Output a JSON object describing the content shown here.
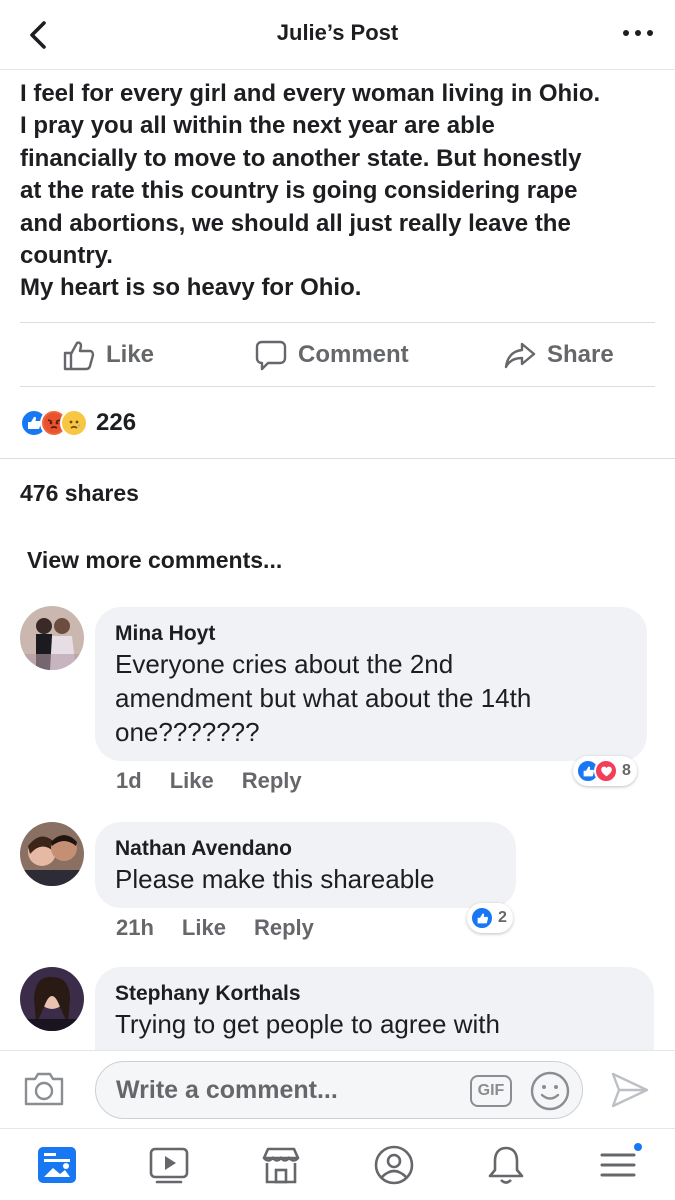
{
  "header": {
    "title": "Julie’s Post"
  },
  "post": {
    "lines": [
      "I feel for every girl and every woman living in Ohio.",
      "I pray you all within the next year are able",
      "financially to move to another state. But honestly",
      "at the rate this country is going considering rape",
      "and abortions, we should all just really leave the",
      "country.",
      "My heart is so heavy for Ohio."
    ]
  },
  "actions": {
    "like": "Like",
    "comment": "Comment",
    "share": "Share"
  },
  "reactions": {
    "types": [
      "like-icon",
      "angry-icon",
      "sad-icon"
    ],
    "count": "226"
  },
  "shares": "476 shares",
  "view_more": "View more comments...",
  "comments": [
    {
      "author": "Mina Hoyt",
      "text_lines": [
        "Everyone cries about the 2nd",
        "amendment but what about the 14th",
        "one???????"
      ],
      "time": "1d",
      "like": "Like",
      "reply": "Reply",
      "reaction_count": "8",
      "reaction_types": [
        "like-icon",
        "love-icon"
      ]
    },
    {
      "author": "Nathan Avendano",
      "text_lines": [
        "Please make this shareable"
      ],
      "time": "21h",
      "like": "Like",
      "reply": "Reply",
      "reaction_count": "2",
      "reaction_types": [
        "like-icon"
      ]
    },
    {
      "author": "Stephany Korthals",
      "text_lines": [
        "Trying to get people to agree with"
      ]
    }
  ],
  "composer": {
    "placeholder": "Write a comment...",
    "gif_label": "GIF"
  },
  "colors": {
    "accent": "#1877f2",
    "text": "#1c1e21",
    "secondary_text": "#65676b",
    "bubble": "#f0f2f5"
  },
  "tabs": [
    "news-feed-icon",
    "watch-icon",
    "marketplace-icon",
    "profile-icon",
    "notifications-icon",
    "menu-icon"
  ]
}
